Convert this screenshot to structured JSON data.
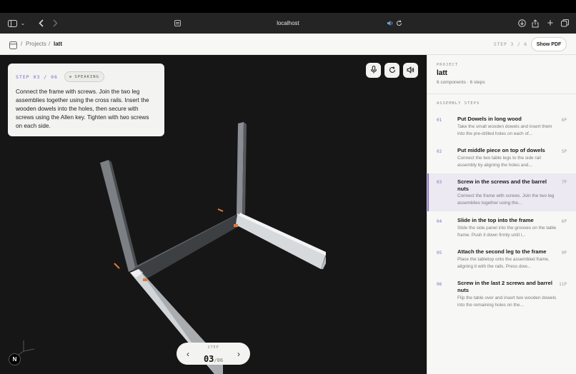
{
  "browser": {
    "url": "localhost"
  },
  "breadcrumb": {
    "projects": "Projects",
    "separator": "/",
    "current": "latt"
  },
  "header": {
    "step_indicator": "STEP 3 / 6",
    "show_pdf": "Show PDF"
  },
  "instruction": {
    "step_label": "STEP 03 / 06",
    "badge": "SPEAKING",
    "text": "Connect the frame with screws. Join the two leg assemblies together using the cross rails. Insert the wooden dowels into the holes, then secure with screws using the Allen key. Tighten with two screws on each side."
  },
  "viewport_controls": {
    "icons": [
      "microphone-icon",
      "reset-icon",
      "speaker-icon"
    ]
  },
  "step_nav": {
    "label": "STEP",
    "current": "03",
    "total": "/06"
  },
  "logo": {
    "letter": "N"
  },
  "project": {
    "kicker": "PROJECT",
    "name": "latt",
    "meta": "6 components · 6 steps"
  },
  "steps_heading": "ASSEMBLY STEPS",
  "steps": [
    {
      "num": "01",
      "title": "Put Dowels in long wood",
      "desc": "Take the small wooden dowels and insert them into the pre-drilled holes on each of...",
      "parts": "6P"
    },
    {
      "num": "02",
      "title": "Put middle piece on top of dowels",
      "desc": "Connect the two table legs to the side rail assembly by aligning the holes and...",
      "parts": "5P"
    },
    {
      "num": "03",
      "title": "Screw in the screws and the barrel nuts",
      "desc": "Connect the frame with screws. Join the two leg assemblies together using the...",
      "parts": "7P"
    },
    {
      "num": "04",
      "title": "Slide in the top into the frame",
      "desc": "Slide the side panel into the grooves on the table frame. Push it down firmly until i...",
      "parts": "6P"
    },
    {
      "num": "05",
      "title": "Attach the second leg to the frame",
      "desc": "Place the tabletop onto the assembled frame, aligning it with the rails. Press dow...",
      "parts": "9P"
    },
    {
      "num": "06",
      "title": "Screw in the last 2 screws and barrel nuts",
      "desc": "Flip the table over and insert two wooden dowels into the remaining holes on the...",
      "parts": "11P"
    }
  ],
  "active_step_index": 2,
  "colors": {
    "accent": "#7a77c8",
    "active_bg": "#ece9f2",
    "viewport_bg": "#161616"
  }
}
